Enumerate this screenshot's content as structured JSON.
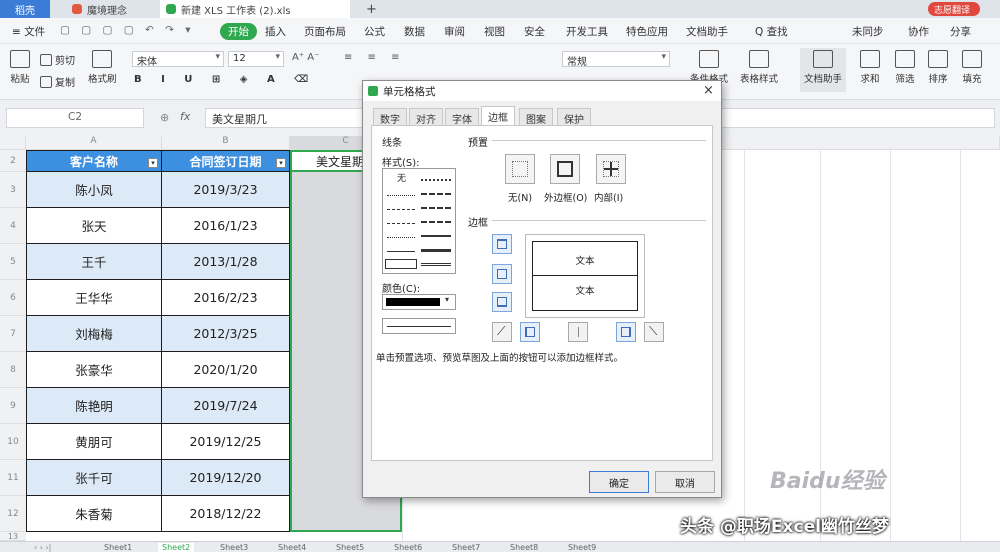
{
  "tabs": {
    "home": "稻壳",
    "t1": "魔境理念",
    "t2": "新建 XLS 工作表 (2).xls",
    "add": "+",
    "user": "志愿翻译"
  },
  "menu": {
    "file": "文件",
    "items": [
      "开始",
      "插入",
      "页面布局",
      "公式",
      "数据",
      "审阅",
      "视图",
      "安全",
      "开发工具",
      "特色应用",
      "文档助手"
    ],
    "search": "Q 查找",
    "sync": "未同步",
    "collab": "协作",
    "share": "分享"
  },
  "ribbon": {
    "paste": "粘贴",
    "cut": "剪切",
    "copy": "复制",
    "format_painter": "格式刷",
    "font": "宋体",
    "size": "12",
    "number_format": "常规",
    "conditional": "条件格式",
    "table_style": "表格样式",
    "sum": "求和",
    "filter": "筛选",
    "sort": "排序",
    "fill": "填充",
    "cell": "单元格",
    "convert": "文档助手"
  },
  "formula": {
    "namebox": "C2",
    "fx": "fx",
    "value": "美文星期几"
  },
  "sheet": {
    "col_headers": [
      "A",
      "B",
      "C"
    ],
    "row_numbers": [
      "2",
      "3",
      "4",
      "5",
      "6",
      "7",
      "8",
      "9",
      "10",
      "11",
      "12",
      "13"
    ],
    "headers": [
      "客户名称",
      "合同签订日期",
      "美文星期"
    ],
    "names": [
      "陈小凤",
      "张天",
      "王千",
      "王华华",
      "刘梅梅",
      "张豪华",
      "陈艳明",
      "黄朋可",
      "张千可",
      "朱香菊"
    ],
    "dates": [
      "2019/3/23",
      "2016/1/23",
      "2013/1/28",
      "2016/2/23",
      "2012/3/25",
      "2020/1/20",
      "2019/7/24",
      "2019/12/25",
      "2019/12/20",
      "2018/12/22"
    ]
  },
  "sheettabs": [
    "Sheet1",
    "Sheet2",
    "Sheet3",
    "Sheet4",
    "Sheet5",
    "Sheet6",
    "Sheet7",
    "Sheet8",
    "Sheet9"
  ],
  "dialog": {
    "title": "单元格格式",
    "close": "×",
    "tabs": [
      "数字",
      "对齐",
      "字体",
      "边框",
      "图案",
      "保护"
    ],
    "line_group": "线条",
    "style_label": "样式(S):",
    "none_label": "无",
    "color_label": "颜色(C):",
    "preset_group": "预置",
    "preset_none": "无(N)",
    "preset_outline": "外边框(O)",
    "preset_inside": "内部(I)",
    "border_group": "边框",
    "preview_text_top": "文本",
    "preview_text_bottom": "文本",
    "hint": "单击预置选项、预览草图及上面的按钮可以添加边框样式。",
    "ok": "确定",
    "cancel": "取消"
  },
  "watermark": {
    "author": "头条 @职场Excel幽竹丝梦",
    "logo": "Baidu经验"
  },
  "colors": {
    "accent_green": "#2fa84f",
    "header_blue": "#3d8fe0",
    "row_blue": "#dce9f6"
  }
}
